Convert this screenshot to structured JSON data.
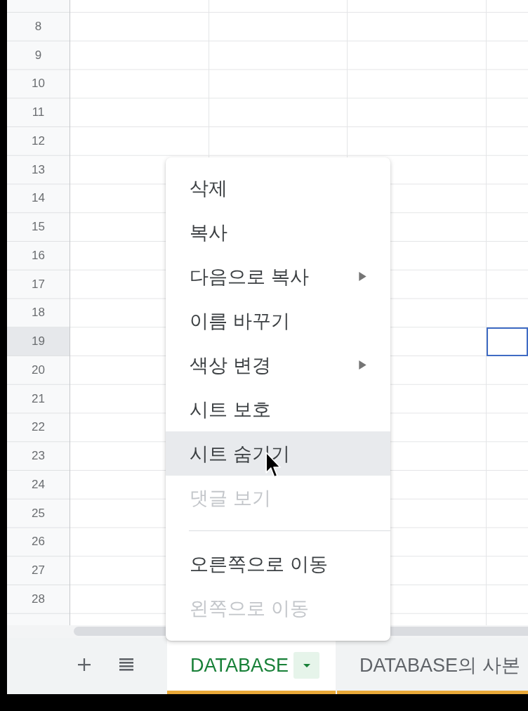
{
  "grid": {
    "columns": [
      {
        "selected": false
      },
      {
        "selected": false
      },
      {
        "selected": false
      },
      {
        "selected": true
      }
    ],
    "rows": [
      {
        "label": "8",
        "selected": false
      },
      {
        "label": "9",
        "selected": false
      },
      {
        "label": "10",
        "selected": false
      },
      {
        "label": "11",
        "selected": false
      },
      {
        "label": "12",
        "selected": false
      },
      {
        "label": "13",
        "selected": false
      },
      {
        "label": "14",
        "selected": false
      },
      {
        "label": "15",
        "selected": false
      },
      {
        "label": "16",
        "selected": false
      },
      {
        "label": "17",
        "selected": false
      },
      {
        "label": "18",
        "selected": false
      },
      {
        "label": "19",
        "selected": true
      },
      {
        "label": "20",
        "selected": false
      },
      {
        "label": "21",
        "selected": false
      },
      {
        "label": "22",
        "selected": false
      },
      {
        "label": "23",
        "selected": false
      },
      {
        "label": "24",
        "selected": false
      },
      {
        "label": "25",
        "selected": false
      },
      {
        "label": "26",
        "selected": false
      },
      {
        "label": "27",
        "selected": false
      },
      {
        "label": "28",
        "selected": false
      }
    ]
  },
  "context_menu": {
    "items": [
      {
        "kind": "item",
        "label": "삭제",
        "disabled": false,
        "highlighted": false,
        "submenu": false
      },
      {
        "kind": "item",
        "label": "복사",
        "disabled": false,
        "highlighted": false,
        "submenu": false
      },
      {
        "kind": "item",
        "label": "다음으로 복사",
        "disabled": false,
        "highlighted": false,
        "submenu": true
      },
      {
        "kind": "item",
        "label": "이름 바꾸기",
        "disabled": false,
        "highlighted": false,
        "submenu": false
      },
      {
        "kind": "item",
        "label": "색상 변경",
        "disabled": false,
        "highlighted": false,
        "submenu": true
      },
      {
        "kind": "item",
        "label": "시트 보호",
        "disabled": false,
        "highlighted": false,
        "submenu": false
      },
      {
        "kind": "item",
        "label": "시트 숨기기",
        "disabled": false,
        "highlighted": true,
        "submenu": false
      },
      {
        "kind": "item",
        "label": "댓글 보기",
        "disabled": true,
        "highlighted": false,
        "submenu": false
      },
      {
        "kind": "separator"
      },
      {
        "kind": "item",
        "label": "오른쪽으로 이동",
        "disabled": false,
        "highlighted": false,
        "submenu": false
      },
      {
        "kind": "item",
        "label": "왼쪽으로 이동",
        "disabled": true,
        "highlighted": false,
        "submenu": false
      }
    ]
  },
  "sheet_bar": {
    "tabs": [
      {
        "label": "DATABASE",
        "selected": true,
        "color": "#e8a838"
      },
      {
        "label": "DATABASE의 사본",
        "selected": false,
        "color": "#e8a838"
      }
    ]
  }
}
